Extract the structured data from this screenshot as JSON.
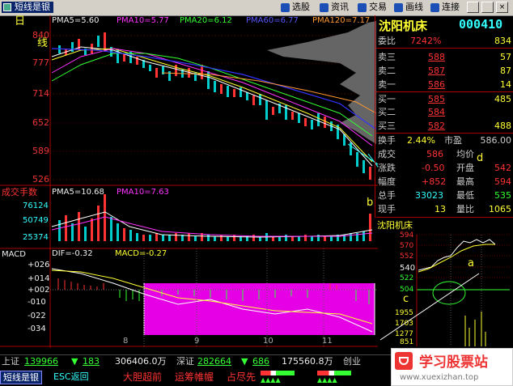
{
  "toolbar": {
    "app_title": "短线是银",
    "buttons": [
      "选股",
      "资讯",
      "交易",
      "画线",
      "连接"
    ]
  },
  "price_panel": {
    "period": "日",
    "period2": "线",
    "ma_labels": [
      "PMA5=5.60",
      "PMA10=5.77",
      "PMA20=6.12",
      "PMA60=6.77",
      "PMA120=7.17"
    ],
    "y_ticks": [
      "840",
      "777",
      "714",
      "652",
      "589",
      "526"
    ],
    "annotations": {
      "b": "b",
      "c": "c",
      "d": "d"
    }
  },
  "volume_panel": {
    "title": "成交手数",
    "ma_labels": [
      "PMA5=10.68",
      "PMA10=7.63"
    ],
    "y_ticks": [
      "76124",
      "50749",
      "25374"
    ]
  },
  "macd_panel": {
    "title": "MACD",
    "labels": [
      "DIF=-0.32",
      "MACD=-0.27"
    ],
    "y_ticks": [
      "+026",
      "+014",
      "+002",
      "-010",
      "-022",
      "-034"
    ],
    "x_ticks": [
      "8",
      "9",
      "10",
      "11"
    ]
  },
  "quote": {
    "stock_name": "沈阳机床",
    "stock_code": "000410",
    "weibi_label": "委比",
    "weibi_value": "7242%",
    "weibi_vol": "834",
    "orders": [
      {
        "label": "卖三",
        "price": "588",
        "vol": "57"
      },
      {
        "label": "卖二",
        "price": "587",
        "vol": "87"
      },
      {
        "label": "卖一",
        "price": "586",
        "vol": "14"
      },
      {
        "label": "买一",
        "price": "585",
        "vol": "485"
      },
      {
        "label": "买二",
        "price": "584",
        "vol": ""
      },
      {
        "label": "买三",
        "price": "582",
        "vol": "488"
      }
    ],
    "stats": [
      {
        "l1": "换手",
        "v1": "2.44%",
        "l2": "市盈",
        "v2": "586.00"
      },
      {
        "l1": "成交",
        "v1": "586",
        "l2": "均价",
        "v2": ""
      },
      {
        "l1": "涨跌",
        "v1": "-0.50",
        "l2": "开盘",
        "v2": "542"
      },
      {
        "l1": "幅度",
        "v1": "+852",
        "l2": "最高",
        "v2": "594"
      },
      {
        "l1": "总手",
        "v1": "33023",
        "l2": "最低",
        "v2": "535"
      },
      {
        "l1": "现手",
        "v1": "13",
        "l2": "量比",
        "v2": "1065"
      }
    ]
  },
  "mini_chart": {
    "title": "沈阳机床",
    "ticks": [
      "594",
      "570",
      "552",
      "540",
      "522",
      "504",
      "1955",
      "1703",
      "1277",
      "851"
    ],
    "annotation": "a"
  },
  "index_bar": {
    "sh_label": "上证",
    "sh_value": "139966",
    "sh_change": "183",
    "sh_amount": "306406.0万",
    "sz_label": "深证",
    "sz_value": "282664",
    "sz_change": "686",
    "sz_amount": "175560.8万",
    "cy_label": "创业"
  },
  "status_bar": {
    "app": "短线是银",
    "esc": "ESC返回",
    "items": [
      "大胆超前",
      "运筹帷幄",
      "占尽先"
    ]
  },
  "watermark": {
    "title": "学习股票站",
    "url": "www.xuexizhan.top"
  }
}
